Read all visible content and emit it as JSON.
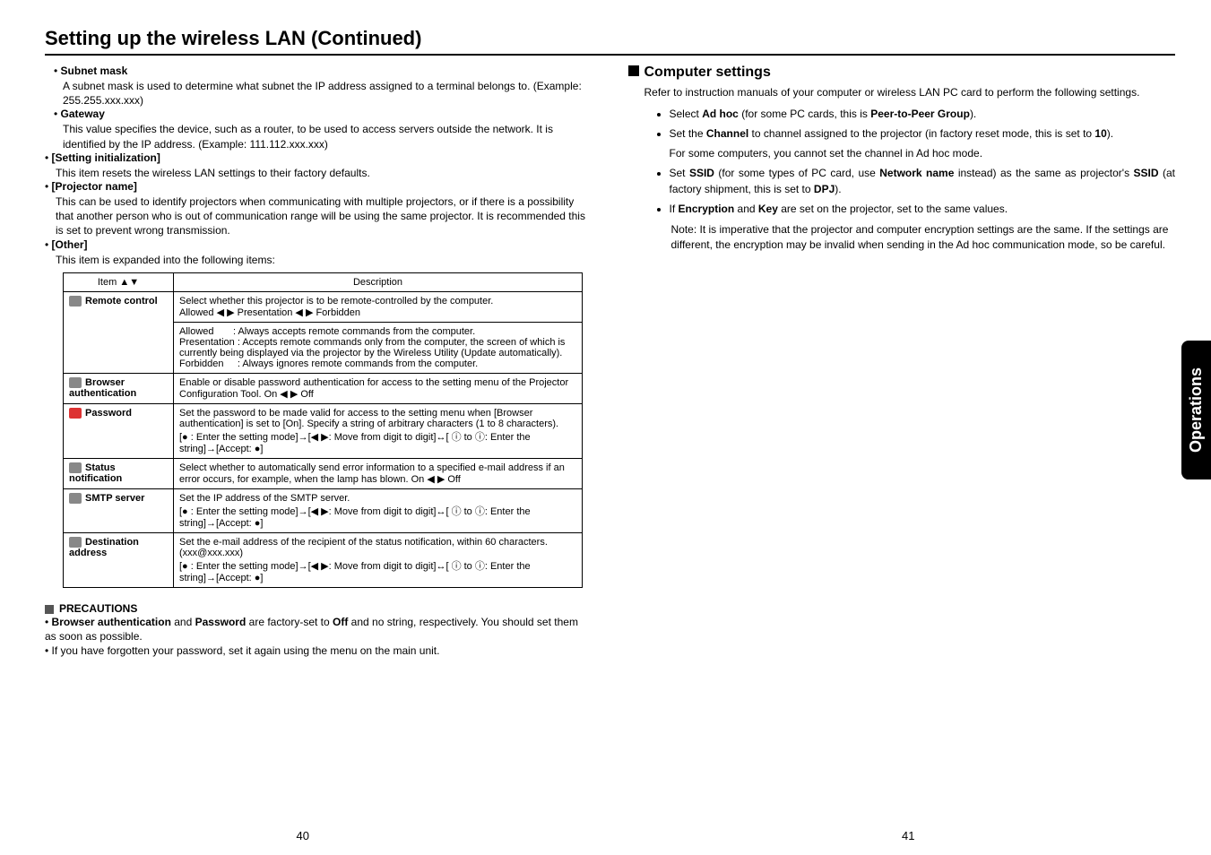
{
  "pageTitle": "Setting up the wireless LAN (Continued)",
  "left": {
    "subnet": {
      "label": "Subnet mask",
      "text": "A subnet mask is used to determine what subnet the IP address assigned to a terminal belongs to. (Example: 255.255.xxx.xxx)"
    },
    "gateway": {
      "label": "Gateway",
      "text": "This value specifies the device, such as a router, to be used to access servers outside the network. It is identified by the IP address. (Example: 111.112.xxx.xxx)"
    },
    "settingInit": {
      "label": "[Setting initialization]",
      "text": "This item resets the wireless LAN settings to their factory defaults."
    },
    "projName": {
      "label": "[Projector name]",
      "text": "This can be used to identify projectors when communicating with multiple projectors, or if there is a possibility that another person who is out of communication range will be using the same projector. It is recommended this is set to prevent wrong transmission."
    },
    "other": {
      "label": "[Other]",
      "text": "This item is expanded into the following items:"
    }
  },
  "tableHeaders": {
    "item": "Item",
    "desc": "Description"
  },
  "rows": {
    "remote": {
      "name": "Remote control",
      "line1": "Select whether this projector is to be remote-controlled by the computer.",
      "line2": "Allowed ◀ ▶ Presentation ◀ ▶ Forbidden",
      "allowed": "Allowed",
      "allowedDesc": ": Always accepts remote commands from the computer.",
      "presentation": "Presentation",
      "presentationDesc": ": Accepts remote commands only from the computer, the screen of which is currently being displayed via the projector by the Wireless Utility (Update automatically).",
      "forbidden": "Forbidden",
      "forbiddenDesc": ": Always ignores remote commands from the computer."
    },
    "browser": {
      "name": "Browser authentication",
      "desc": "Enable or disable password authentication for access to the setting menu of the Projector Configuration Tool.  On ◀ ▶ Off"
    },
    "password": {
      "name": "Password",
      "desc": "Set the password to be made valid for access to the setting menu when [Browser authentication] is set to [On].  Specify a string of arbitrary characters (1 to 8 characters).",
      "desc2": "[● : Enter the setting mode]→[◀ ▶: Move from digit to digit]↔[ ⓘ to ⓘ: Enter the string]→[Accept: ●]"
    },
    "status": {
      "name": "Status notification",
      "desc": "Select whether to automatically send error information to a specified e-mail address if an error occurs, for example, when the lamp has blown.  On ◀ ▶ Off"
    },
    "smtp": {
      "name": "SMTP server",
      "desc": "Set the IP address of the SMTP server.",
      "desc2": "[● : Enter the setting mode]→[◀ ▶: Move from digit to digit]↔[ ⓘ to ⓘ: Enter the string]→[Accept: ●]"
    },
    "dest": {
      "name": "Destination address",
      "desc": "Set the e-mail address of the recipient of the status notification, within 60 characters.  (xxx@xxx.xxx)",
      "desc2": "[● : Enter the setting mode]→[◀ ▶: Move from digit to digit]↔[ ⓘ to ⓘ: Enter the string]→[Accept: ●]"
    }
  },
  "precautions": {
    "heading": "PRECAUTIONS",
    "p1a": "Browser authentication",
    "p1b": " and ",
    "p1c": "Password",
    "p1d": " are factory-set to ",
    "p1e": "Off",
    "p1f": " and no string, respectively. You should set them as soon as possible.",
    "p2": "If you have forgotten your password, set it again using the menu on the main unit."
  },
  "right": {
    "heading": "Computer settings",
    "intro": "Refer to instruction manuals of your computer or wireless LAN PC card to perform the following settings.",
    "b1a": "Select ",
    "b1b": "Ad hoc",
    "b1c": " (for some PC cards, this is ",
    "b1d": "Peer-to-Peer Group",
    "b1e": ").",
    "b2a": "Set the ",
    "b2b": "Channel",
    "b2c": " to channel assigned to the projector (in factory reset mode, this is set to ",
    "b2d": "10",
    "b2e": ").",
    "b2f": "For some computers, you cannot set the channel in Ad hoc mode.",
    "b3a": "Set ",
    "b3b": "SSID",
    "b3c": " (for some types of PC card, use ",
    "b3d": "Network name",
    "b3e": " instead) as the same as projector's ",
    "b3f": "SSID",
    "b3g": " (at factory shipment, this is set to ",
    "b3h": "DPJ",
    "b3i": ").",
    "b4a": "If ",
    "b4b": "Encryption",
    "b4c": " and ",
    "b4d": "Key",
    "b4e": " are set on the projector, set to the same values.",
    "note": "Note: It is imperative that the projector and computer encryption settings are the same. If the settings are different, the encryption may be invalid when sending in the Ad hoc communication mode, so be careful."
  },
  "sideTab": "Operations",
  "pageLeft": "40",
  "pageRight": "41"
}
